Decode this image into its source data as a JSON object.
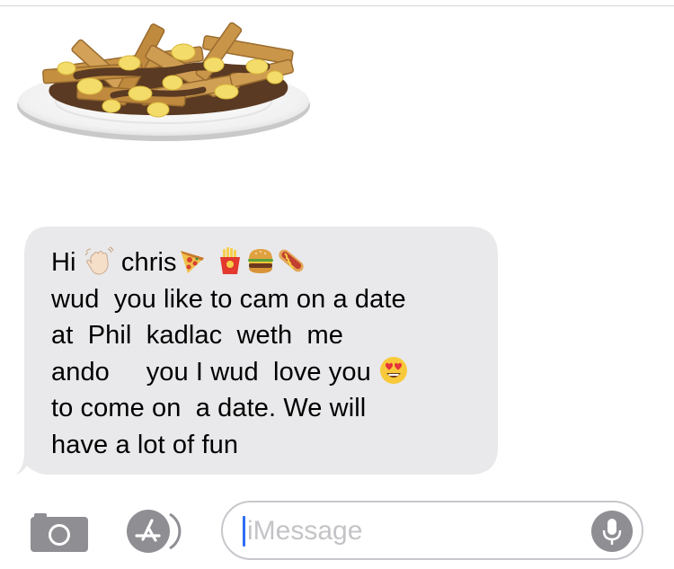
{
  "sticker": {
    "name": "poutine-sticker"
  },
  "message": {
    "lines": [
      {
        "text": "Hi ",
        "after": [
          {
            "emoji": "waving-hand-icon"
          },
          {
            "text": " chris"
          },
          {
            "emoji": "pizza-icon"
          },
          {
            "text": " "
          },
          {
            "emoji": "fries-icon"
          },
          {
            "emoji": "burger-icon"
          },
          {
            "emoji": "hotdog-icon"
          }
        ]
      },
      {
        "text": "wud  you like to cam on a date"
      },
      {
        "text": "at  Phil  kadlac  weth  me"
      },
      {
        "text": "ando     you I wud  love you ",
        "after": [
          {
            "emoji": "heart-eyes-icon"
          }
        ]
      },
      {
        "text": "to come on  a date. We will"
      },
      {
        "text": "have a lot of fun"
      }
    ],
    "bubble_color": "#e9e9eb"
  },
  "composer": {
    "placeholder": "iMessage",
    "camera_icon": "camera-icon",
    "appstore_icon": "app-store-icon",
    "mic_icon": "microphone-icon",
    "icon_color": "#8e8e93"
  }
}
